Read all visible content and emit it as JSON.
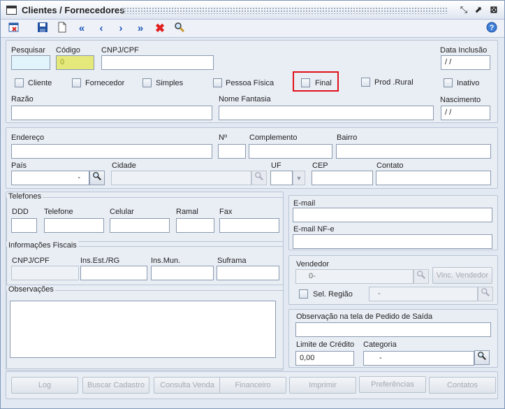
{
  "window": {
    "title": "Clientes / Fornecedores"
  },
  "titlebar_controls": [
    "restore-icon",
    "maximize-icon",
    "close-icon"
  ],
  "toolbar": {
    "icons": [
      "exit-icon",
      "save-icon",
      "new-document-icon",
      "first-record-icon",
      "previous-record-icon",
      "next-record-icon",
      "last-record-icon",
      "delete-icon",
      "search-icon"
    ],
    "help_icon": "help-icon"
  },
  "colors": {
    "highlight_border": "#e0101a",
    "codigo_bg": "#e5e87a",
    "pesquisar_bg": "#e1f3fb"
  },
  "header": {
    "pesquisar_label": "Pesquisar",
    "pesquisar_value": "",
    "codigo_label": "Código",
    "codigo_value": "0",
    "cnpj_label": "CNPJ/CPF",
    "cnpj_value": "",
    "data_inclusao_label": "Data Inclusão",
    "data_inclusao_value": " / /",
    "checks": {
      "cliente": "Cliente",
      "fornecedor": "Fornecedor",
      "simples": "Simples",
      "pessoa_fisica": "Pessoa Física",
      "final": "Final",
      "prod_rural": "Prod .Rural",
      "inativo": "Inativo"
    },
    "razao_label": "Razão",
    "razao_value": "",
    "nome_fantasia_label": "Nome Fantasia",
    "nome_fantasia_value": "",
    "nascimento_label": "Nascimento",
    "nascimento_value": " / /"
  },
  "endereco": {
    "endereco_label": "Endereço",
    "numero_label": "Nº",
    "complemento_label": "Complemento",
    "bairro_label": "Bairro",
    "pais_label": "País",
    "pais_value": "-",
    "cidade_label": "Cidade",
    "uf_label": "UF",
    "cep_label": "CEP",
    "contato_label": "Contato"
  },
  "telefones": {
    "title": "Telefones",
    "ddd_label": "DDD",
    "telefone_label": "Telefone",
    "celular_label": "Celular",
    "ramal_label": "Ramal",
    "fax_label": "Fax"
  },
  "email": {
    "email_label": "E-mail",
    "email_nfe_label": "E-mail  NF-e"
  },
  "fiscais": {
    "title": "Informações Fiscais",
    "cnpj_label": "CNPJ/CPF",
    "ins_est_label": "Ins.Est./RG",
    "ins_mun_label": "Ins.Mun.",
    "suframa_label": "Suframa"
  },
  "vendedor": {
    "label": "Vendedor",
    "value": "0-",
    "vinc_button": "Vinc. Vendedor",
    "sel_regiao_label": "Sel. Região",
    "regiao_value": "-"
  },
  "observacoes": {
    "title": "Observações"
  },
  "pedido": {
    "obs_label": "Observação na tela de Pedido de Saída",
    "limite_label": "Limite de Crédito",
    "limite_value": "0,00",
    "categoria_label": "Categoria",
    "categoria_value": "-"
  },
  "footer_buttons": [
    "Log",
    "Buscar Cadastro",
    "Consulta Venda",
    "Financeiro",
    "Imprimir",
    "Preferências",
    "Contatos"
  ]
}
